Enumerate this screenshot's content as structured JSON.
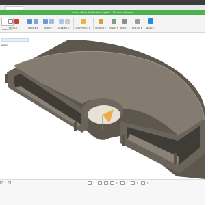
{
  "window": {
    "tab_label": ""
  },
  "banner": {
    "text": "You are all set with the latest update.",
    "link": "Find out what's new"
  },
  "toolbar": {
    "workspace_label": "DESIGN ▾",
    "groups": [
      {
        "label": "SKETCH ▾"
      },
      {
        "label": "CREATE ▾"
      },
      {
        "label": "MODIFY ▾"
      },
      {
        "label": "ASSEMBLE ▾"
      },
      {
        "label": "CONSTRUCT ▾"
      },
      {
        "label": "INSPECT ▾"
      },
      {
        "label": "INSERT ▾"
      },
      {
        "label": "MAKE ▾"
      },
      {
        "label": "ADD-INS ▾"
      },
      {
        "label": "SELECT ▾"
      }
    ]
  },
  "browser": {
    "header": "",
    "items": [
      "Settings",
      "",
      "",
      "",
      "",
      ""
    ]
  },
  "colors": {
    "banner": "#4caf50",
    "part_top": "#847c70",
    "part_wall": "#6b645a",
    "part_dark": "#3f3b35",
    "accent_orange": "#f0a030",
    "select_blue": "#1e90d8"
  },
  "viewcube": {
    "face": ""
  },
  "status": {
    "page": "1"
  }
}
